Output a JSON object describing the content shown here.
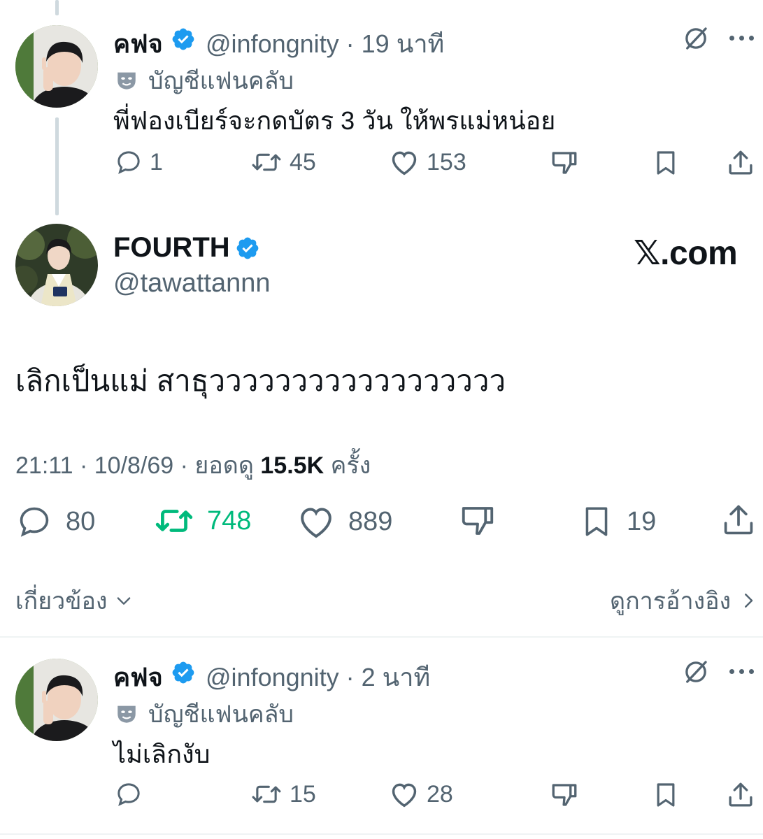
{
  "reply1": {
    "name": "คฟจ",
    "handle": "@infongnity",
    "time": "· 19 นาที",
    "fan_label": "บัญชีแฟนคลับ",
    "text": "พี่ฟองเบียร์จะกดบัตร 3 วัน ให้พรแม่หน่อย",
    "replies": "1",
    "reposts": "45",
    "likes": "153"
  },
  "main": {
    "name": "FOURTH",
    "handle": "@tawattannn",
    "watermark": "𝕏.com",
    "text": "เลิกเป็นแม่ สาธุวววววววววววววววววว",
    "time": "21:11 · 10/8/69 · ยอดดู",
    "views": "15.5K",
    "views_suffix": "ครั้ง",
    "replies": "80",
    "reposts": "748",
    "likes": "889",
    "bookmarks": "19",
    "related_label": "เกี่ยวข้อง",
    "quotes_label": "ดูการอ้างอิง"
  },
  "reply2": {
    "name": "คฟจ",
    "handle": "@infongnity",
    "time": "· 2 นาที",
    "fan_label": "บัญชีแฟนคลับ",
    "text": "ไม่เลิกงับ",
    "replies": "",
    "reposts": "15",
    "likes": "28"
  },
  "colors": {
    "verified": "#1d9bf0",
    "repost_active": "#00ba7c",
    "secondary_text": "#536471"
  },
  "icons": [
    "reply-icon",
    "repost-icon",
    "like-icon",
    "dislike-icon",
    "bookmark-icon",
    "share-icon",
    "grok-icon",
    "more-icon",
    "verified-icon",
    "fan-mask-icon"
  ]
}
